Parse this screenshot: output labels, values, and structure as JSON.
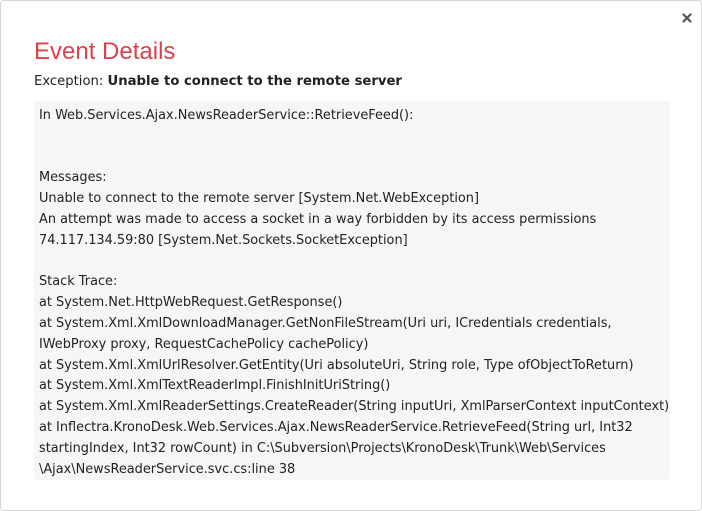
{
  "dialog": {
    "title": "Event Details",
    "title_color": "#d9434b",
    "close_icon": "close-icon",
    "exception_label": "Exception:",
    "exception_message": "Unable to connect to the remote server",
    "details_background": "#f4f7f4",
    "details_lines": [
      "In Web.Services.Ajax.NewsReaderService::RetrieveFeed():",
      "",
      "",
      "Messages:",
      "Unable to connect to the remote server [System.Net.WebException]",
      "An attempt was made to access a socket in a way forbidden by its access permissions",
      "74.117.134.59:80 [System.Net.Sockets.SocketException]",
      "",
      "Stack Trace:",
      "at System.Net.HttpWebRequest.GetResponse()",
      "at System.Xml.XmlDownloadManager.GetNonFileStream(Uri uri, ICredentials credentials,",
      "IWebProxy proxy, RequestCachePolicy cachePolicy)",
      "at System.Xml.XmlUrlResolver.GetEntity(Uri absoluteUri, String role, Type ofObjectToReturn)",
      "at System.Xml.XmlTextReaderImpl.FinishInitUriString()",
      "at System.Xml.XmlReaderSettings.CreateReader(String inputUri, XmlParserContext inputContext)",
      "at Inflectra.KronoDesk.Web.Services.Ajax.NewsReaderService.RetrieveFeed(String url, Int32",
      "startingIndex, Int32 rowCount) in C:\\Subversion\\Projects\\KronoDesk\\Trunk\\Web\\Services",
      "\\Ajax\\NewsReaderService.svc.cs:line 38"
    ]
  }
}
